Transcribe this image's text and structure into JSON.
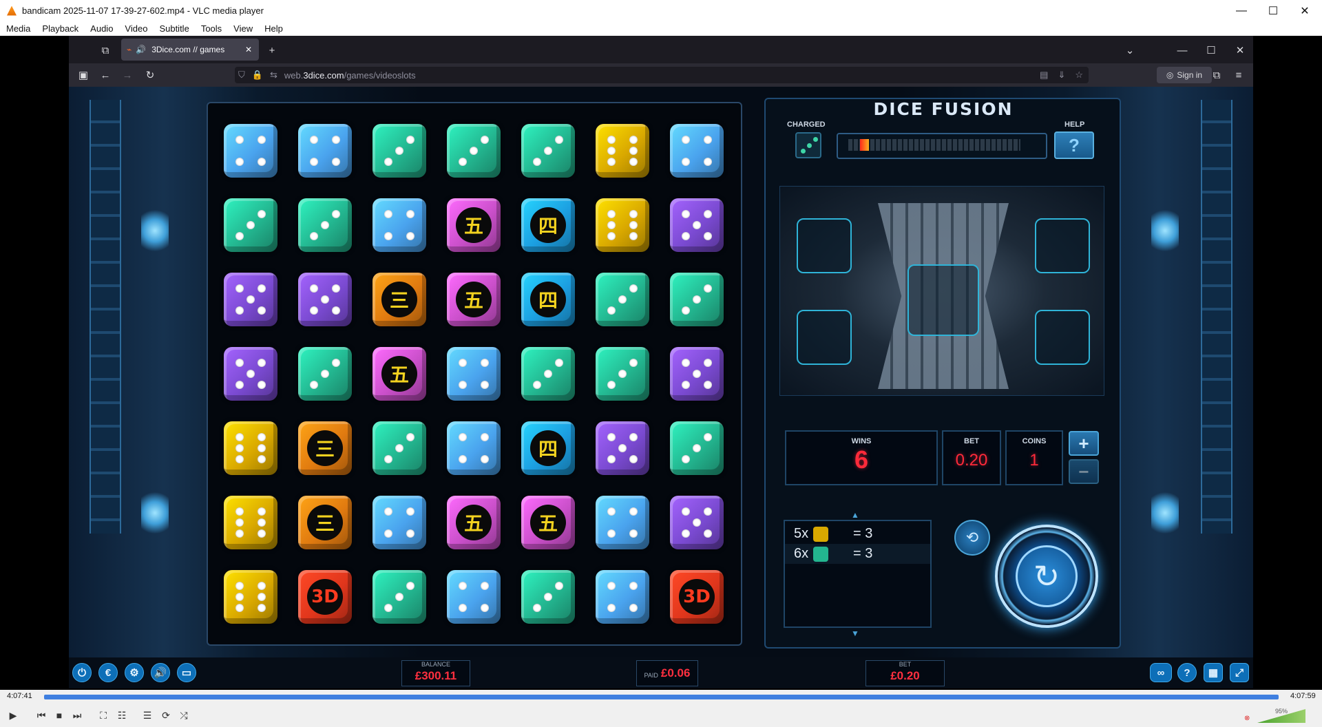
{
  "vlc": {
    "title": "bandicam 2025-11-07 17-39-27-602.mp4 - VLC media player",
    "menu": [
      "Media",
      "Playback",
      "Audio",
      "Video",
      "Subtitle",
      "Tools",
      "View",
      "Help"
    ],
    "time_elapsed": "4:07:41",
    "time_total": "4:07:59",
    "seek_fraction": 0.999,
    "volume": "95%"
  },
  "browser": {
    "tab_title": "3Dice.com // games",
    "url_prefix": "web.",
    "url_domain": "3dice.com",
    "url_path": "/games/videoslots",
    "sign_in": "Sign in"
  },
  "game": {
    "title": "DICE FUSION",
    "charged_label": "CHARGED",
    "help_label": "HELP",
    "help_symbol": "?",
    "charge_level": 0.05,
    "grid": [
      [
        "blue4",
        "blue4",
        "teal3",
        "teal3",
        "teal3",
        "gold6",
        "blue4"
      ],
      [
        "teal3",
        "teal3",
        "blue4",
        "pink5",
        "cyan4",
        "gold6",
        "purple5"
      ],
      [
        "purple5",
        "purple5",
        "orange3",
        "pink5",
        "cyan4",
        "teal3",
        "teal3"
      ],
      [
        "purple5",
        "teal3",
        "pink5",
        "blue4",
        "teal3",
        "teal3",
        "purple5"
      ],
      [
        "gold6",
        "orange3",
        "teal3",
        "blue4",
        "cyan4",
        "purple5",
        "teal3"
      ],
      [
        "gold6",
        "orange3",
        "blue4",
        "pink5",
        "pink5",
        "blue4",
        "purple5"
      ],
      [
        "gold6",
        "red3d",
        "teal3",
        "blue4",
        "teal3",
        "blue4",
        "red3d"
      ]
    ],
    "glyphs": {
      "pink5": "五",
      "cyan4": "四",
      "orange3": "三",
      "red3d": "3D"
    },
    "wins_label": "WINS",
    "wins_value": "6",
    "bet_label": "BET",
    "bet_value": "0.20",
    "coins_label": "COINS",
    "coins_value": "1",
    "plus": "+",
    "minus": "−",
    "win_lines": [
      {
        "count": "5x",
        "die": "gold6",
        "result": "= 3"
      },
      {
        "count": "6x",
        "die": "teal3",
        "result": "= 3"
      }
    ],
    "balance_label": "BALANCE",
    "balance_value": "£300.11",
    "paid_label": "PAID",
    "paid_value": "£0.06",
    "bottom_bet_label": "BET",
    "bottom_bet_value": "£0.20"
  },
  "colors": {
    "blue4": "#4aa3ee",
    "teal3": "#23b58f",
    "gold6": "#d9a800",
    "purple5": "#7a4ad1",
    "pink5": "#c94fc9",
    "cyan4": "#1c9ee0",
    "orange3": "#e07a10",
    "red3d": "#e0361c"
  }
}
